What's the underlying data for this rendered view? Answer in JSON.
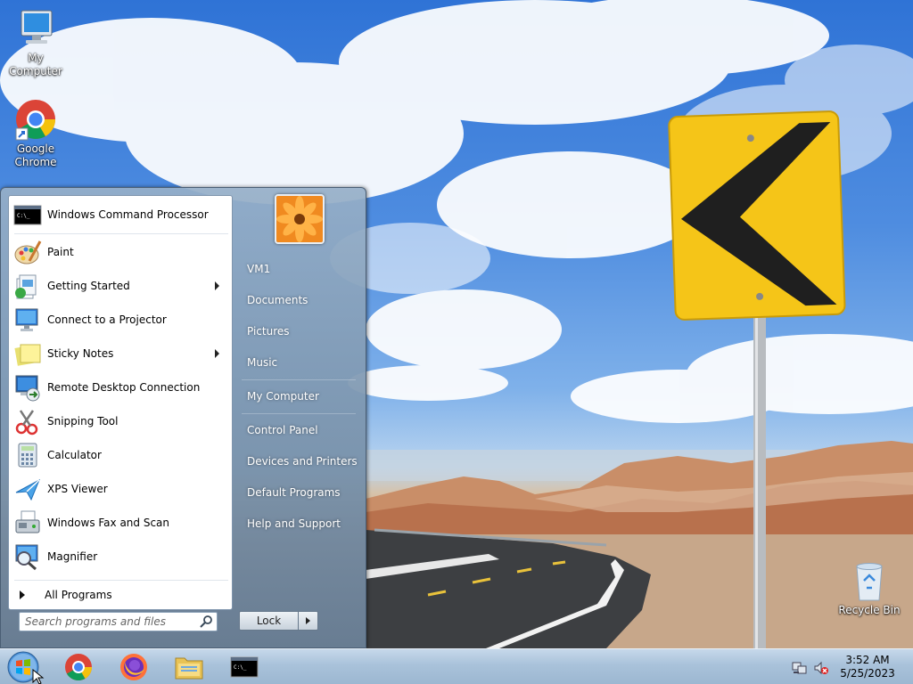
{
  "desktop": {
    "icons": [
      {
        "label": "My Computer",
        "icon": "my-computer-icon"
      },
      {
        "label": "Google Chrome",
        "icon": "chrome-icon"
      },
      {
        "label": "Recycle Bin",
        "icon": "recycle-bin-icon"
      }
    ]
  },
  "start_menu": {
    "programs": [
      {
        "label": "Windows Command Processor",
        "icon": "cmd-icon",
        "has_submenu": false
      },
      {
        "label": "Paint",
        "icon": "paint-icon",
        "has_submenu": false
      },
      {
        "label": "Getting Started",
        "icon": "getting-started-icon",
        "has_submenu": true
      },
      {
        "label": "Connect to a Projector",
        "icon": "projector-icon",
        "has_submenu": false
      },
      {
        "label": "Sticky Notes",
        "icon": "sticky-notes-icon",
        "has_submenu": true
      },
      {
        "label": "Remote Desktop Connection",
        "icon": "remote-desktop-icon",
        "has_submenu": false
      },
      {
        "label": "Snipping Tool",
        "icon": "snipping-tool-icon",
        "has_submenu": false
      },
      {
        "label": "Calculator",
        "icon": "calculator-icon",
        "has_submenu": false
      },
      {
        "label": "XPS Viewer",
        "icon": "xps-viewer-icon",
        "has_submenu": false
      },
      {
        "label": "Windows Fax and Scan",
        "icon": "fax-scan-icon",
        "has_submenu": false
      },
      {
        "label": "Magnifier",
        "icon": "magnifier-icon",
        "has_submenu": false
      }
    ],
    "all_programs_label": "All Programs",
    "search_placeholder": "Search programs and files",
    "user_tile_icon": "flower-user-picture",
    "right_links": [
      "VM1",
      "Documents",
      "Pictures",
      "Music",
      "My Computer",
      "Control Panel",
      "Devices and Printers",
      "Default Programs",
      "Help and Support"
    ],
    "lock_label": "Lock"
  },
  "taskbar": {
    "pinned": [
      "chrome-icon",
      "firefox-icon",
      "file-explorer-icon",
      "cmd-icon"
    ],
    "tray_icons": [
      "network-icon",
      "volume-muted-icon"
    ],
    "clock": {
      "time": "3:52 AM",
      "date": "5/25/2023"
    }
  },
  "colors": {
    "taskbar": "#a9c2da",
    "start_menu_right": "#7d95ad",
    "sign_yellow": "#f5c518"
  }
}
